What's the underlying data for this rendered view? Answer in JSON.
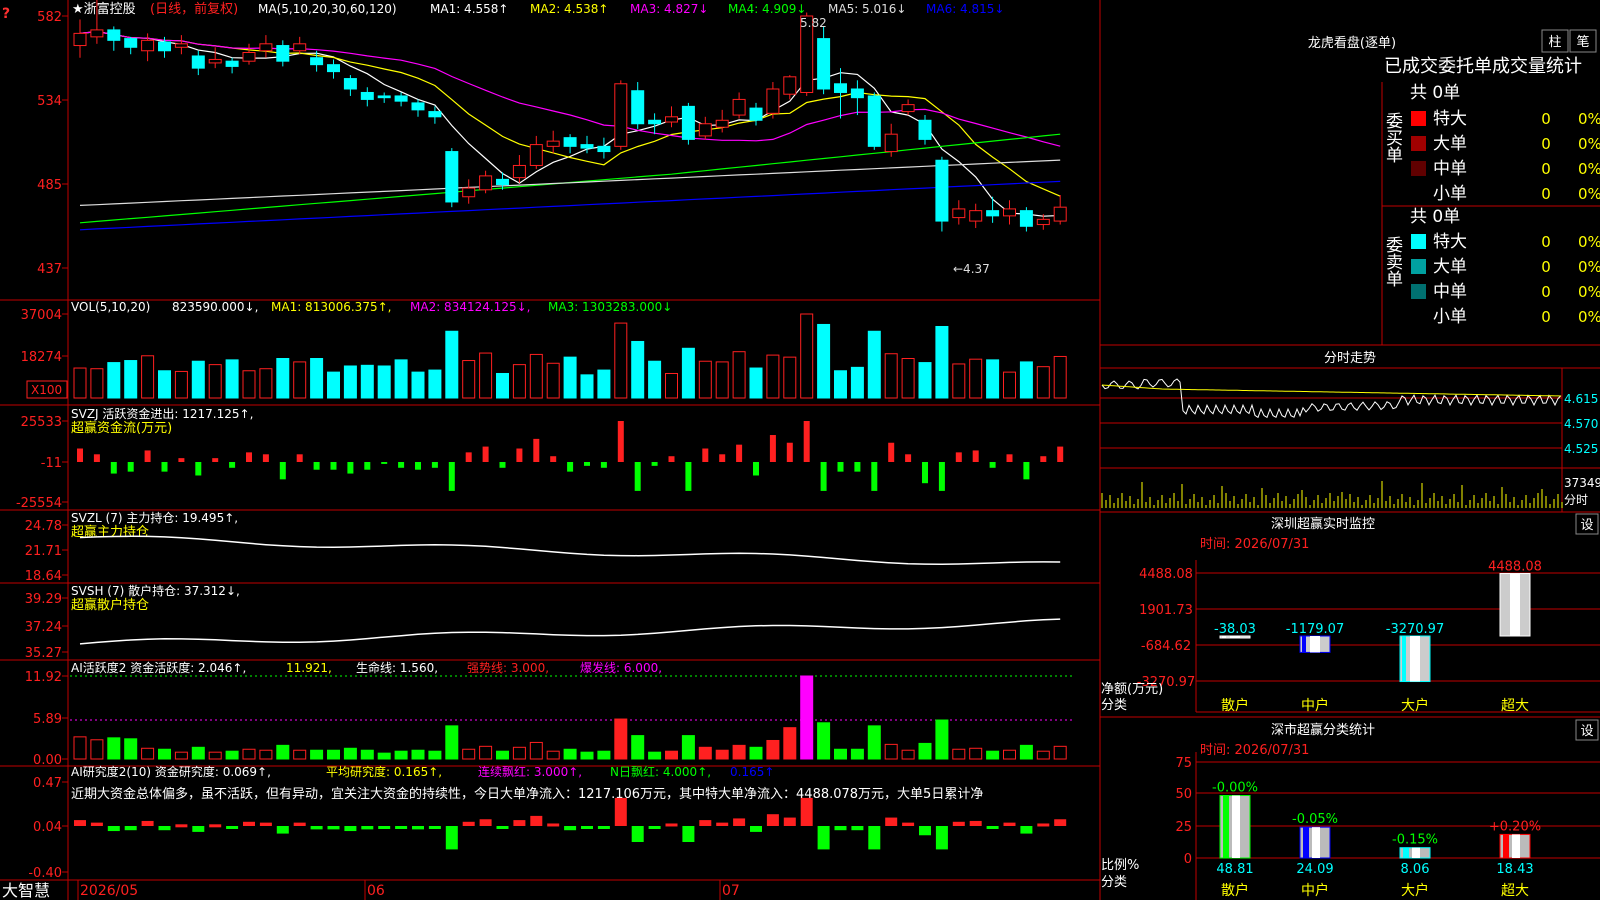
{
  "app": {
    "brand": "大智慧",
    "title": "★浙富控股",
    "mode": "(日线，前复权)"
  },
  "colors": {
    "up": "#ff2020",
    "down": "#00ffff",
    "yellow": "#ffff00",
    "magenta": "#ff00ff",
    "green": "#00ff00",
    "white": "#ffffff",
    "frame": "#c00000"
  },
  "main_chart": {
    "ma_label": "MA(5,10,20,30,60,120)",
    "ma": [
      {
        "name": "MA1:",
        "value": "4.558",
        "dir": "↑",
        "color": "#ffffff"
      },
      {
        "name": "MA2:",
        "value": "4.538",
        "dir": "↑",
        "color": "#ffff00"
      },
      {
        "name": "MA3:",
        "value": "4.827",
        "dir": "↓",
        "color": "#ff00ff"
      },
      {
        "name": "MA4:",
        "value": "4.909",
        "dir": "↓",
        "color": "#00ff00"
      },
      {
        "name": "MA5:",
        "value": "5.016",
        "dir": "↓",
        "color": "#dddddd"
      },
      {
        "name": "MA6:",
        "value": "4.815",
        "dir": "↓",
        "color": "#0000ff"
      }
    ],
    "y_ticks": [
      "582",
      "534",
      "485",
      "437"
    ],
    "high_label": "5.82",
    "low_label": "←4.37"
  },
  "vol_panel": {
    "label": "VOL(5,10,20)",
    "value": "823590.000↓,",
    "ma1": "MA1: 813006.375↑,",
    "ma2": "MA2: 834124.125↓,",
    "ma3": "MA3: 1303283.000↓",
    "y_ticks": [
      "37004",
      "18274"
    ],
    "unit": "X100"
  },
  "svzj_panel": {
    "label": "SVZJ 活跃资金进出: 1217.125↑,",
    "sub": "超赢资金流(万元)",
    "y_ticks": [
      "25533",
      "-11",
      "-25554"
    ]
  },
  "svzl_panel": {
    "label": "SVZL (7) 主力持仓: 19.495↑,",
    "sub": "超赢主力持仓",
    "y_ticks": [
      "24.78",
      "21.71",
      "18.64"
    ]
  },
  "svsh_panel": {
    "label": "SVSH (7) 散户持仓: 37.312↓,",
    "sub": "超赢散户持仓",
    "y_ticks": [
      "39.29",
      "37.24",
      "35.27"
    ]
  },
  "ai2_panel": {
    "label": "AI活跃度2 资金活跃度: 2.046↑,",
    "v2": "11.921,",
    "life": "生命线: 1.560,",
    "strong": "强势线: 3.000,",
    "burst": "爆发线: 6.000,",
    "y_ticks": [
      "11.92",
      "5.89",
      "0.00"
    ]
  },
  "ai_study_panel": {
    "label": "AI研究度2(10) 资金研究度: 0.069↑,",
    "avg": "平均研究度: 0.165↑,",
    "cont": "连续飘红: 3.000↑,",
    "nday": "N日飘红: 4.000↑,",
    "last": "0.165↑",
    "commentary": "近期大资金总体偏多，虽不活跃，但有异动，宜关注大资金的持续性，今日大单净流入：1217.106万元，其中特大单净流入：4488.078万元，大单5日累计净",
    "y_ticks": [
      "0.47",
      "0.04",
      "-0.40"
    ]
  },
  "x_axis": {
    "labels": [
      "2026/05",
      "06",
      "07"
    ]
  },
  "right_panel": {
    "lhb_title": "龙虎看盘(逐单)",
    "btn_bar": "柱",
    "btn_pen": "笔",
    "stats_title": "已成交委托单成交量统计",
    "buy_label": "委买单",
    "sell_label": "委卖单",
    "buy_total": "共 0单",
    "sell_total": "共 0单",
    "buy_rows": [
      {
        "name": "特大",
        "count": "0",
        "pct": "0%",
        "color": "#ff0000"
      },
      {
        "name": "大单",
        "count": "0",
        "pct": "0%",
        "color": "#a00000"
      },
      {
        "name": "中单",
        "count": "0",
        "pct": "0%",
        "color": "#600000"
      },
      {
        "name": "小单",
        "count": "0",
        "pct": "0%",
        "color": ""
      }
    ],
    "sell_rows": [
      {
        "name": "特大",
        "count": "0",
        "pct": "0%",
        "color": "#00ffff"
      },
      {
        "name": "大单",
        "count": "0",
        "pct": "0%",
        "color": "#00a0a0"
      },
      {
        "name": "中单",
        "count": "0",
        "pct": "0%",
        "color": "#007070"
      },
      {
        "name": "小单",
        "count": "0",
        "pct": "0%",
        "color": ""
      }
    ],
    "intraday_title": "分时走势",
    "intraday_ticks": [
      "4.615",
      "4.570",
      "4.525"
    ],
    "intraday_vol": "37349",
    "intraday_vol_label": "分时",
    "monitor_title": "深圳超赢实时监控",
    "monitor_btn": "设",
    "monitor_time": "时间: 2026/07/31",
    "monitor_y_ticks": [
      "4488.08",
      "1901.73",
      "-684.62",
      "-3270.97"
    ],
    "monitor_net_label": "净额(万元)",
    "monitor_cat_label": "分类",
    "monitor_categories": [
      "散户",
      "中户",
      "大户",
      "超大"
    ],
    "monitor_values": [
      "-38.03",
      "-1179.07",
      "-3270.97",
      "4488.08"
    ],
    "class_title": "深市超赢分类统计",
    "class_btn": "设",
    "class_time": "时间: 2026/07/31",
    "class_y_ticks": [
      "75",
      "50",
      "25",
      "0"
    ],
    "class_ratio_label": "比例%",
    "class_cat_label": "分类",
    "class_changes": [
      "-0.00%",
      "-0.05%",
      "-0.15%",
      "+0.20%"
    ],
    "class_values": [
      "48.81",
      "24.09",
      "8.06",
      "18.43"
    ],
    "class_categories": [
      "散户",
      "中户",
      "大户",
      "超大"
    ]
  }
}
